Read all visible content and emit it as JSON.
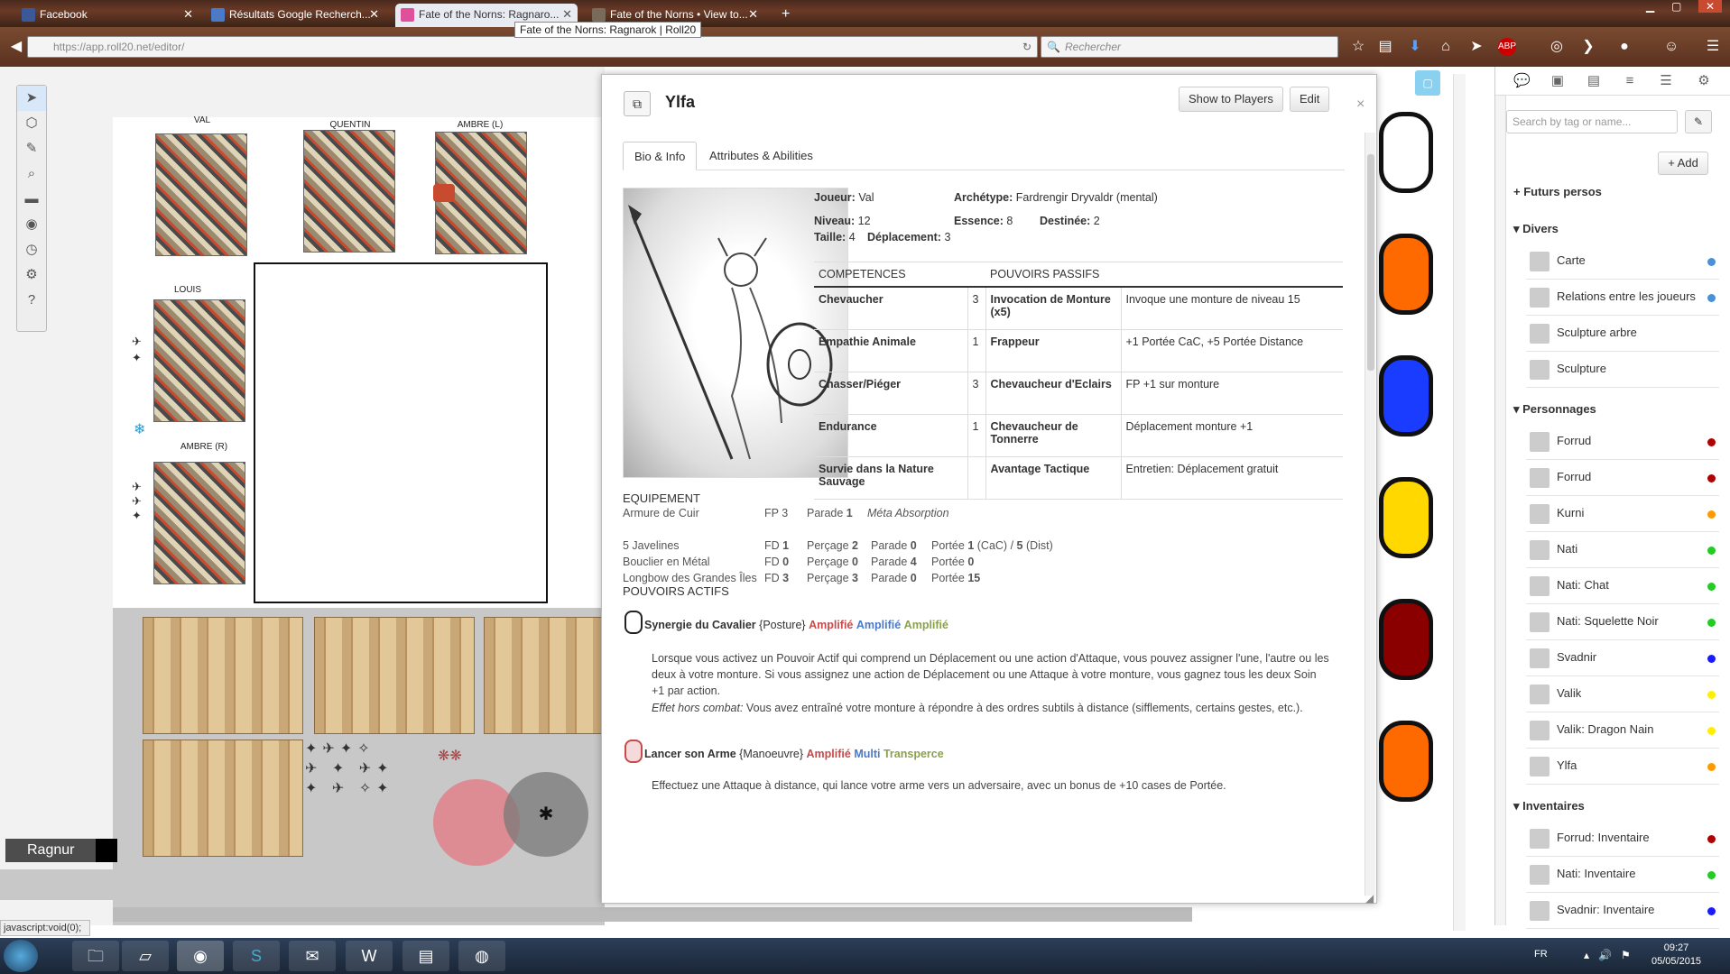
{
  "browser": {
    "tabs": [
      {
        "label": "Facebook",
        "color": "#3b5998"
      },
      {
        "label": "Résultats Google Recherch...",
        "color": "#4a7ac8"
      },
      {
        "label": "Fate of the Norns: Ragnaro...",
        "color": "#e0509a"
      },
      {
        "label": "Fate of the Norns • View to...",
        "color": "#7a6a5a"
      }
    ],
    "new_tab": "+",
    "tooltip": "Fate of the Norns: Ragnarok | Roll20",
    "url": "https://app.roll20.net/editor/",
    "search_placeholder": "Rechercher"
  },
  "canvas": {
    "tokens": [
      {
        "label": "VAL"
      },
      {
        "label": "QUENTIN"
      },
      {
        "label": "AMBRE (L)"
      },
      {
        "label": "LOUIS"
      },
      {
        "label": "AMBRE (R)"
      }
    ],
    "player": "Ragnur",
    "status": "javascript:void(0);"
  },
  "toolbar": {
    "tools": [
      "select-icon",
      "cube-icon",
      "brush-icon",
      "zoom-icon",
      "ruler-icon",
      "eye-icon",
      "clock-icon",
      "compass-icon",
      "help-icon"
    ],
    "help": "?"
  },
  "dialog": {
    "title": "Ylfa",
    "show_players": "Show to Players",
    "edit": "Edit",
    "close": "×",
    "tabs": [
      "Bio & Info",
      "Attributes & Abilities"
    ],
    "joueur_label": "Joueur:",
    "joueur": "Val",
    "archetype_label": "Archétype:",
    "archetype": "Fardrengir Dryvaldr (mental)",
    "niveau_label": "Niveau:",
    "niveau": "12",
    "essence_label": "Essence:",
    "essence": "8",
    "destinee_label": "Destinée:",
    "destinee": "2",
    "taille_label": "Taille:",
    "taille": "4",
    "deplacement_label": "Déplacement:",
    "deplacement": "3",
    "competences_header": "COMPETENCES",
    "pouvoirs_header": "POUVOIRS PASSIFS",
    "rows": [
      {
        "comp": "Chevaucher",
        "val": "3",
        "pouvoir": "Invocation de Monture (x5)",
        "desc": "Invoque une monture de niveau 15"
      },
      {
        "comp": "Empathie Animale",
        "val": "1",
        "pouvoir": "Frappeur",
        "desc": "+1 Portée CaC, +5 Portée Distance"
      },
      {
        "comp": "Chasser/Piéger",
        "val": "3",
        "pouvoir": "Chevaucheur d'Eclairs",
        "desc": "FP +1 sur monture"
      },
      {
        "comp": "Endurance",
        "val": "1",
        "pouvoir": "Chevaucheur de Tonnerre",
        "desc": "Déplacement monture +1"
      },
      {
        "comp": "Survie dans la Nature Sauvage",
        "val": "",
        "pouvoir": "Avantage Tactique",
        "desc": "Entretien: Déplacement gratuit"
      }
    ],
    "equipement_header": "EQUIPEMENT",
    "armure": {
      "name": "Armure de Cuir",
      "fp": "FP 3",
      "parade_label": "Parade",
      "parade": "1",
      "extra": "Méta Absorption"
    },
    "weapons": [
      {
        "name": "5 Javelines",
        "fd": "FD",
        "fd_val": "1",
        "per": "Perçage",
        "per_val": "2",
        "par": "Parade",
        "par_val": "0",
        "por": "Portée",
        "por_val": "1",
        "por_extra": "(CaC) /",
        "por_val2": "5",
        "por_extra2": "(Dist)"
      },
      {
        "name": "Bouclier en Métal",
        "fd": "FD",
        "fd_val": "0",
        "per": "Perçage",
        "per_val": "0",
        "par": "Parade",
        "par_val": "4",
        "por": "Portée",
        "por_val": "0"
      },
      {
        "name": "Longbow des Grandes Îles",
        "fd": "FD",
        "fd_val": "3",
        "per": "Perçage",
        "per_val": "3",
        "par": "Parade",
        "par_val": "0",
        "por": "Portée",
        "por_val": "15"
      }
    ],
    "pouvoirs_actifs_header": "POUVOIRS ACTIFS",
    "actifs": [
      {
        "name": "Synergie du Cavalier",
        "type": "{Posture}",
        "tags": [
          "Amplifié",
          "Amplifié",
          "Amplifié"
        ],
        "text": "Lorsque vous activez un Pouvoir Actif qui comprend un Déplacement ou une action d'Attaque, vous pouvez assigner l'une, l'autre ou les deux à votre monture. Si vous assignez une action de Déplacement ou une Attaque à votre monture, vous gagnez tous les deux Soin +1 par action.",
        "hc_label": "Effet hors combat:",
        "hc_text": "Vous avez entraîné votre monture à répondre à des ordres subtils à distance (sifflements, certains gestes, etc.)."
      },
      {
        "name": "Lancer son Arme",
        "type": "{Manoeuvre}",
        "tags": [
          "Amplifié",
          "Multi",
          "Transperce"
        ],
        "text": "Effectuez une Attaque à distance, qui lance votre arme vers un adversaire, avec un bonus de +10 cases de Portée."
      }
    ]
  },
  "dice_colors": [
    "#ffffff",
    "#ff6a00",
    "#1a3cff",
    "#ffd800",
    "#8a0000",
    "#ff6a00"
  ],
  "journal": {
    "search_placeholder": "Search by tag or name...",
    "add": "+ Add",
    "futurs": "Futurs persos",
    "divers": "Divers",
    "divers_items": [
      {
        "label": "Carte",
        "dot": "#4a90d9"
      },
      {
        "label": "Relations entre les joueurs",
        "dot": "#4a90d9"
      },
      {
        "label": "Sculpture arbre",
        "dot": ""
      },
      {
        "label": "Sculpture",
        "dot": ""
      }
    ],
    "personnages": "Personnages",
    "personnages_items": [
      {
        "label": "Forrud",
        "dot": "#b00000"
      },
      {
        "label": "Forrud",
        "dot": "#b00000"
      },
      {
        "label": "Kurni",
        "dot": "#ff9900"
      },
      {
        "label": "Nati",
        "dot": "#22cc22"
      },
      {
        "label": "Nati: Chat",
        "dot": "#22cc22"
      },
      {
        "label": "Nati: Squelette Noir",
        "dot": "#22cc22"
      },
      {
        "label": "Svadnir",
        "dot": "#1a1aff"
      },
      {
        "label": "Valik",
        "dot": "#ffee00"
      },
      {
        "label": "Valik: Dragon Nain",
        "dot": "#ffee00"
      },
      {
        "label": "Ylfa",
        "dot": "#ff9900"
      }
    ],
    "inventaires": "Inventaires",
    "inventaires_items": [
      {
        "label": "Forrud: Inventaire",
        "dot": "#b00000"
      },
      {
        "label": "Nati: Inventaire",
        "dot": "#22cc22"
      },
      {
        "label": "Svadnir: Inventaire",
        "dot": "#1a1aff"
      }
    ]
  },
  "taskbar": {
    "lang": "FR",
    "time": "09:27",
    "date": "05/05/2015"
  }
}
